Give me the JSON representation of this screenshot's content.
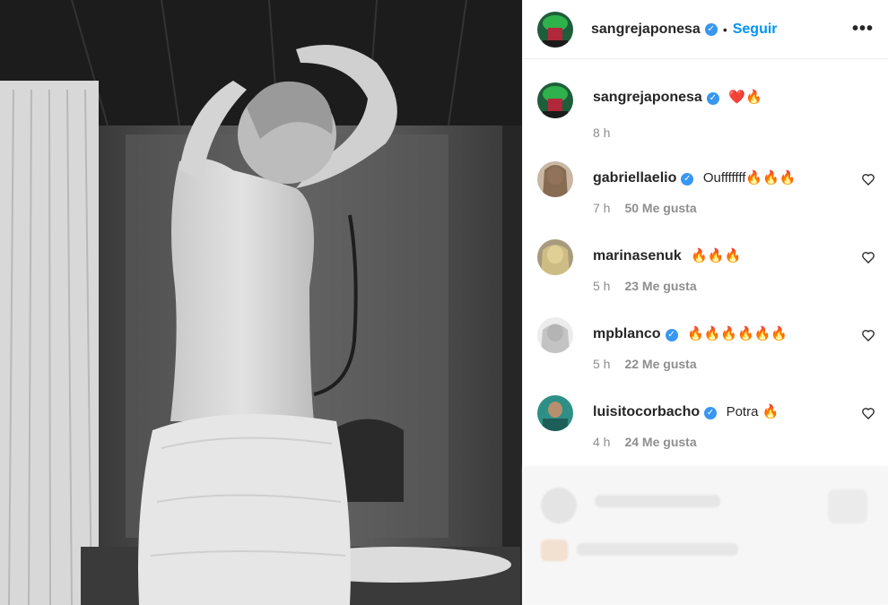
{
  "post": {
    "author": "sangrejaponesa",
    "separator": "•",
    "follow_label": "Seguir",
    "more_label": "•••",
    "caption": "❤️🔥",
    "caption_time": "8 h"
  },
  "comments": [
    {
      "user": "gabriellaelio",
      "verified": true,
      "text": "Oufffffff🔥🔥🔥",
      "time": "7 h",
      "likes": "50 Me gusta"
    },
    {
      "user": "marinasenuk",
      "verified": false,
      "text": "🔥🔥🔥",
      "time": "5 h",
      "likes": "23 Me gusta"
    },
    {
      "user": "mpblanco",
      "verified": true,
      "text": "🔥🔥🔥🔥🔥🔥",
      "time": "5 h",
      "likes": "22 Me gusta"
    },
    {
      "user": "luisitocorbacho",
      "verified": true,
      "text": "Potra 🔥",
      "time": "4 h",
      "likes": "24 Me gusta"
    }
  ],
  "colors": {
    "link": "#0095f6",
    "verified": "#3897f0",
    "meta": "#8e8e8e"
  },
  "icons": {
    "verified": "verified-badge-icon",
    "like": "heart-outline-icon",
    "more": "more-options-icon"
  }
}
